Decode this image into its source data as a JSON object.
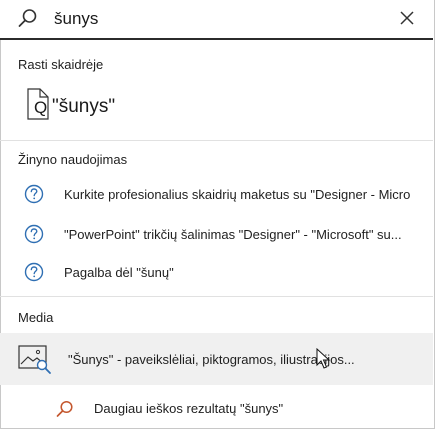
{
  "search": {
    "query": "šunys"
  },
  "sections": {
    "slides_title": "Rasti skaidrėje",
    "help_title": "Žinyno naudojimas",
    "media_title": "Media"
  },
  "slide_result": {
    "label": "\"šunys\"",
    "q_letter": "Q"
  },
  "help_items": [
    {
      "label": "Kurkite profesionalius skaidrių maketus su \"Designer - Micro"
    },
    {
      "label": "\"PowerPoint\" trikčių šalinimas \"Designer\" - \"Microsoft\" su..."
    },
    {
      "label": "Pagalba dėl \"šunų\""
    }
  ],
  "media_item": {
    "label": "\"Šunys\" - paveikslėliai, piktogramos, iliustracijos..."
  },
  "more_results": {
    "label": "Daugiau ieškos rezultatų \"šunys\""
  },
  "colors": {
    "accent_blue": "#2f6fb3",
    "accent_orange": "#c4572e",
    "hover_bg": "#f0f0f0"
  }
}
